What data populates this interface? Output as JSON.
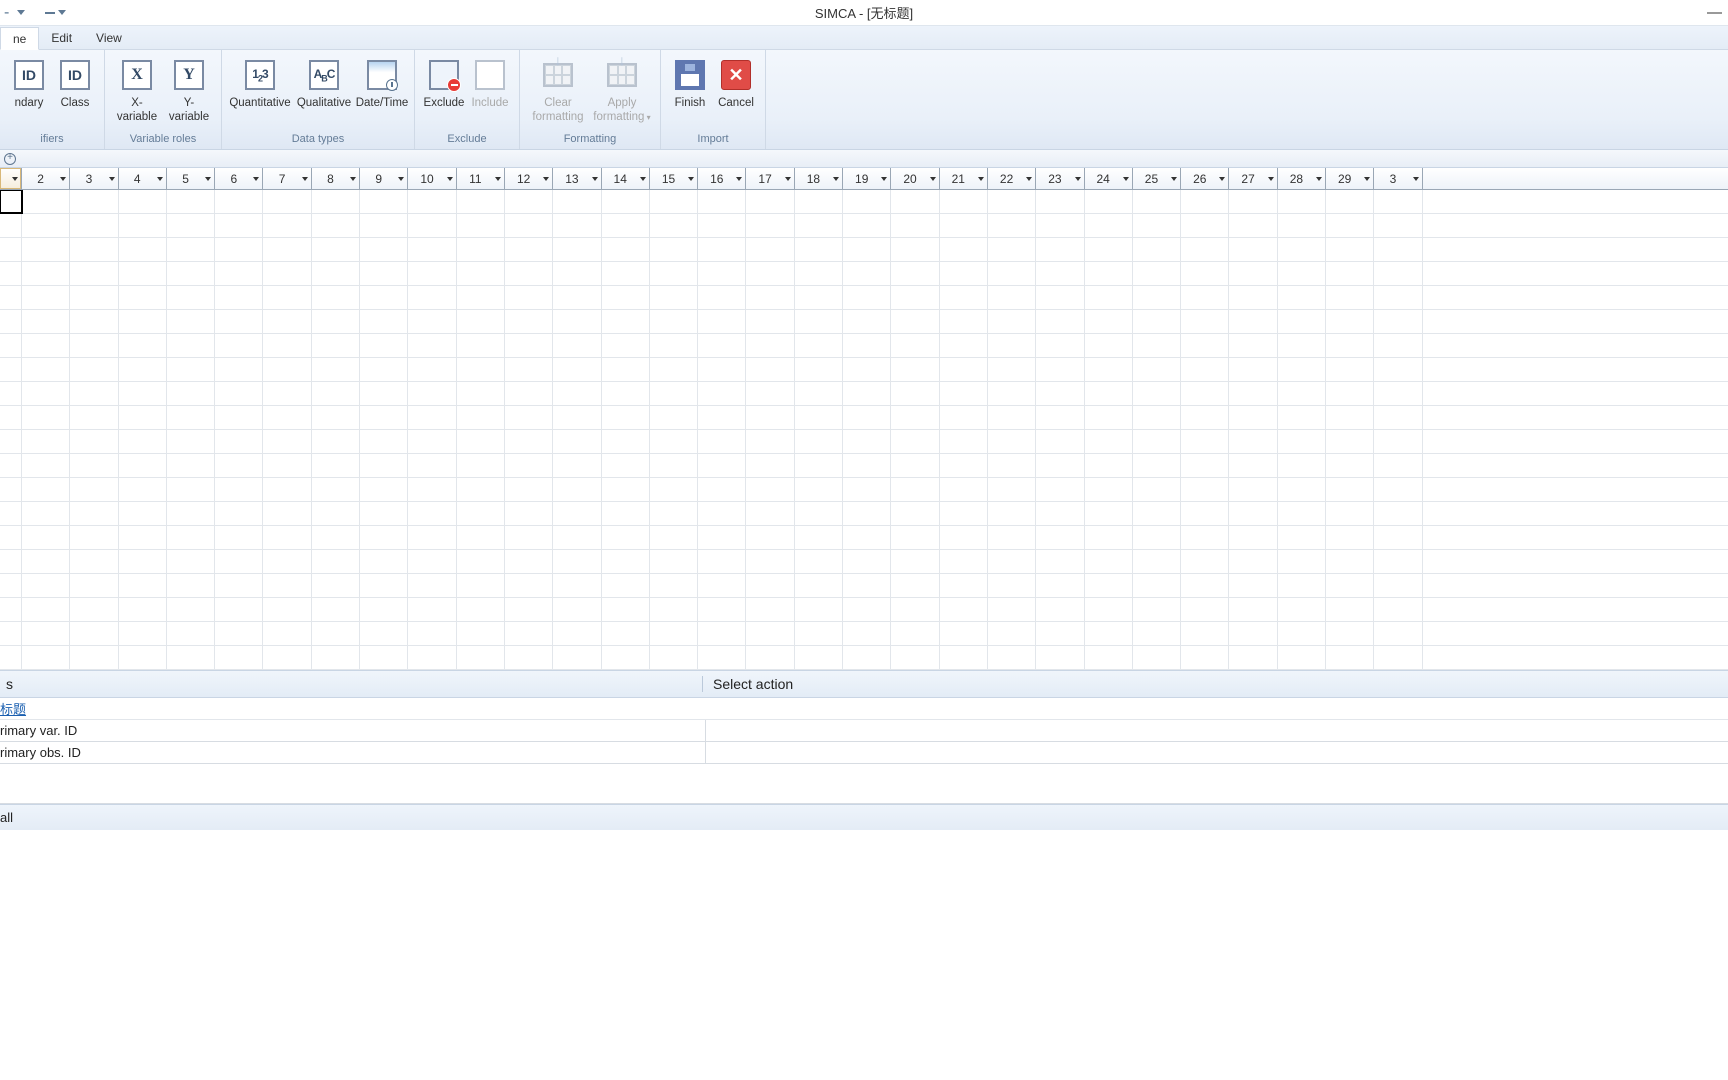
{
  "title": "SIMCA - [无标题]",
  "menu": {
    "tabs": [
      "ne",
      "Edit",
      "View"
    ],
    "active": 0
  },
  "ribbon": {
    "groups": [
      {
        "label": "ifiers",
        "buttons": [
          {
            "label": "ndary",
            "icon": "id-secondary"
          },
          {
            "label": "Class",
            "icon": "id-class"
          }
        ]
      },
      {
        "label": "Variable roles",
        "buttons": [
          {
            "label": "X-variable",
            "icon": "x-var"
          },
          {
            "label": "Y-variable",
            "icon": "y-var"
          }
        ]
      },
      {
        "label": "Data types",
        "buttons": [
          {
            "label": "Quantitative",
            "icon": "quant"
          },
          {
            "label": "Qualitative",
            "icon": "qual"
          },
          {
            "label": "Date/Time",
            "icon": "datetime"
          }
        ]
      },
      {
        "label": "Exclude",
        "buttons": [
          {
            "label": "Exclude",
            "icon": "exclude"
          },
          {
            "label": "Include",
            "icon": "include",
            "disabled": true
          }
        ]
      },
      {
        "label": "Formatting",
        "buttons": [
          {
            "label": "Clear formatting",
            "icon": "clear-fmt",
            "disabled": true
          },
          {
            "label": "Apply formatting",
            "icon": "apply-fmt",
            "disabled": true,
            "dropdown": true
          }
        ]
      },
      {
        "label": "Import",
        "buttons": [
          {
            "label": "Finish",
            "icon": "finish"
          },
          {
            "label": "Cancel",
            "icon": "cancel"
          }
        ]
      }
    ]
  },
  "columns": [
    "",
    "2",
    "3",
    "4",
    "5",
    "6",
    "7",
    "8",
    "9",
    "10",
    "11",
    "12",
    "13",
    "14",
    "15",
    "16",
    "17",
    "18",
    "19",
    "20",
    "21",
    "22",
    "23",
    "24",
    "25",
    "26",
    "27",
    "28",
    "29",
    "3"
  ],
  "bottom": {
    "left_header": "s",
    "right_header": "Select action",
    "link": "标题",
    "rows": [
      "rimary var. ID",
      "rimary obs. ID"
    ],
    "status": "all"
  }
}
